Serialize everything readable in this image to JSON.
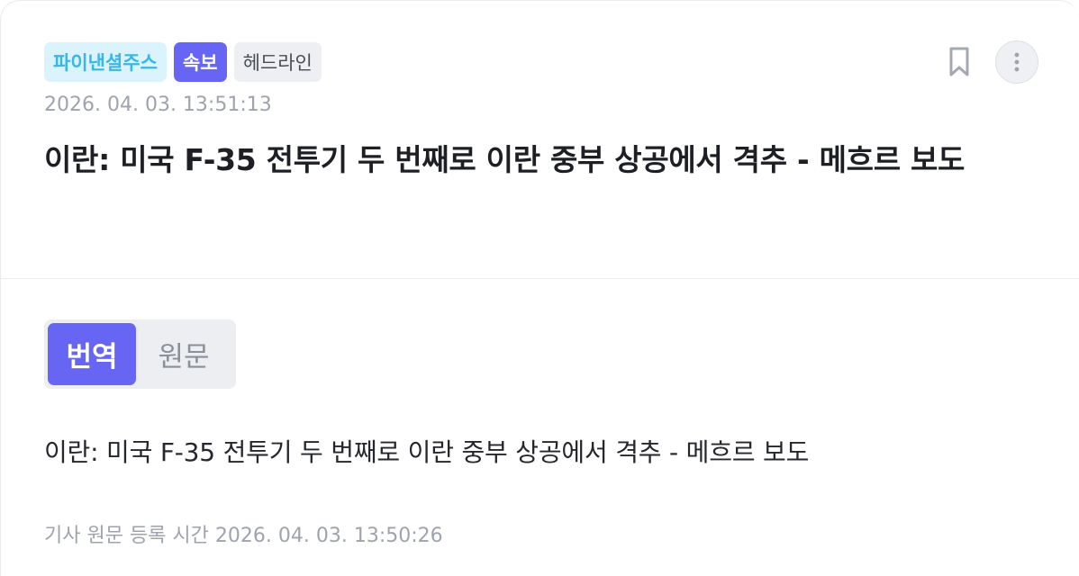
{
  "tags": {
    "source": "파이낸셜주스",
    "breaking": "속보",
    "headline": "헤드라인"
  },
  "article": {
    "timestamp": "2026. 04. 03. 13:51:13",
    "title": "이란: 미국 F-35 전투기 두 번째로 이란 중부 상공에서 격추 - 메흐르 보도",
    "body": "이란: 미국 F-35 전투기 두 번째로 이란 중부 상공에서 격추 - 메흐르 보도",
    "original_registered": "기사 원문 등록 시간 2026. 04. 03. 13:50:26"
  },
  "toggle": {
    "translated": "번역",
    "original": "원문",
    "selected": "translated"
  },
  "icons": {
    "bookmark": "bookmark-icon",
    "more": "more-vertical-icon"
  },
  "colors": {
    "accent": "#6766f4",
    "source_tag_bg": "#dbf3fc",
    "source_tag_text": "#38b6e6",
    "muted_text": "#9ea3ad"
  }
}
